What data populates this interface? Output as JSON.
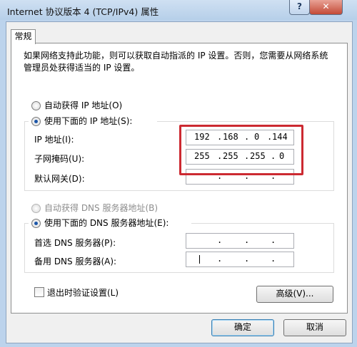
{
  "window": {
    "title": "Internet 协议版本 4 (TCP/IPv4) 属性",
    "help_glyph": "?",
    "close_glyph": "✕"
  },
  "tab": {
    "label": "常规"
  },
  "description": "如果网络支持此功能，则可以获取自动指派的 IP 设置。否则，您需要从网络系统管理员处获得适当的 IP 设置。",
  "ip": {
    "auto_label": "自动获得 IP 地址(O)",
    "manual_label": "使用下面的 IP 地址(S):",
    "auto_selected": false,
    "manual_selected": true,
    "address_label": "IP 地址(I):",
    "address": [
      "192",
      "168",
      "0",
      "144"
    ],
    "subnet_label": "子网掩码(U):",
    "subnet": [
      "255",
      "255",
      "255",
      "0"
    ],
    "gateway_label": "默认网关(D):",
    "gateway": [
      "",
      "",
      "",
      ""
    ]
  },
  "dns": {
    "auto_label": "自动获得 DNS 服务器地址(B)",
    "manual_label": "使用下面的 DNS 服务器地址(E):",
    "manual_selected": true,
    "preferred_label": "首选 DNS 服务器(P):",
    "preferred": [
      "",
      "",
      "",
      ""
    ],
    "alternate_label": "备用 DNS 服务器(A):",
    "alternate": [
      "",
      "",
      "",
      ""
    ]
  },
  "separator": ".",
  "validate_on_exit": {
    "label": "退出时验证设置(L)",
    "checked": false
  },
  "buttons": {
    "advanced": "高级(V)...",
    "ok": "确定",
    "cancel": "取消"
  },
  "colors": {
    "highlight": "#cc2a31",
    "radio_dot": "#1c56a8",
    "title_bar": "#bcd3ec"
  }
}
